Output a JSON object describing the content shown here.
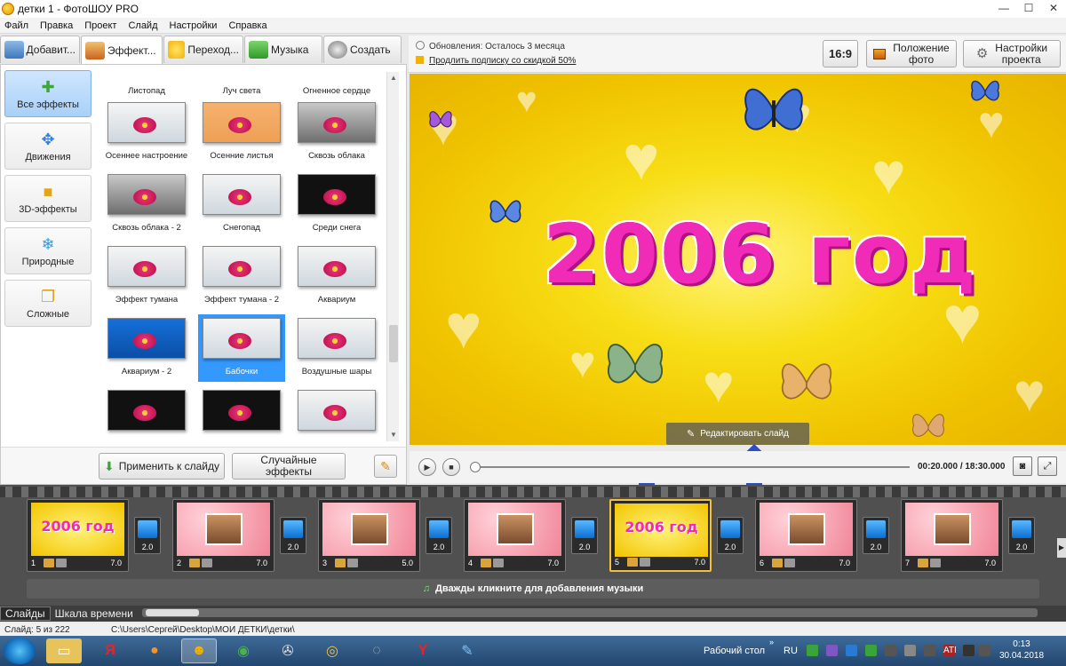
{
  "window": {
    "title": "детки 1 - ФотоШОУ PRO"
  },
  "menu": [
    "Файл",
    "Правка",
    "Проект",
    "Слайд",
    "Настройки",
    "Справка"
  ],
  "left_tabs": [
    "Добавит...",
    "Эффект...",
    "Переход...",
    "Музыка",
    "Создать"
  ],
  "categories": [
    "Все эффекты",
    "Движения",
    "3D-эффекты",
    "Природные",
    "Сложные"
  ],
  "effects_top_row": [
    "Листопад",
    "Луч света",
    "Огненное сердце"
  ],
  "effects": [
    {
      "label": "Осеннее настроение",
      "style": "white"
    },
    {
      "label": "Осенние листья",
      "style": "autumn"
    },
    {
      "label": "Сквозь облака",
      "style": "cloud"
    },
    {
      "label": "Сквозь облака - 2",
      "style": "cloud"
    },
    {
      "label": "Снегопад",
      "style": "white"
    },
    {
      "label": "Среди снега",
      "style": "dark"
    },
    {
      "label": "Эффект тумана",
      "style": "white"
    },
    {
      "label": "Эффект тумана - 2",
      "style": "white"
    },
    {
      "label": "Аквариум",
      "style": "white"
    },
    {
      "label": "Аквариум - 2",
      "style": "blue"
    },
    {
      "label": "Бабочки",
      "style": "white",
      "selected": true
    },
    {
      "label": "Воздушные шары",
      "style": "white"
    },
    {
      "label": "",
      "style": "dark"
    },
    {
      "label": "",
      "style": "dark"
    },
    {
      "label": "",
      "style": "white"
    }
  ],
  "buttons": {
    "apply": "Применить к слайду",
    "random_line1": "Случайные",
    "random_line2": "эффекты"
  },
  "updates": {
    "text": "Обновления: Осталось 3 месяца",
    "promo": "Продлить подписку со скидкой 50%"
  },
  "toolbar": {
    "ratio": "16:9",
    "photo_pos_1": "Положение",
    "photo_pos_2": "фото",
    "settings_1": "Настройки",
    "settings_2": "проекта"
  },
  "preview": {
    "title": "2006 год",
    "edit_label": "Редактировать слайд"
  },
  "playback": {
    "timecode": "00:20.000 / 18:30.000",
    "progress_fraction": 0.0
  },
  "slides": [
    {
      "num": "1",
      "dur": "7.0",
      "kind": "yellow",
      "text": "2006 год"
    },
    {
      "num": "2",
      "dur": "7.0",
      "kind": "pink",
      "text": ""
    },
    {
      "num": "3",
      "dur": "5.0",
      "kind": "pink",
      "text": ""
    },
    {
      "num": "4",
      "dur": "7.0",
      "kind": "pink",
      "text": ""
    },
    {
      "num": "5",
      "dur": "7.0",
      "kind": "yellow",
      "text": "2006 год",
      "selected": true
    },
    {
      "num": "6",
      "dur": "7.0",
      "kind": "pink",
      "text": ""
    },
    {
      "num": "7",
      "dur": "7.0",
      "kind": "pink",
      "text": ""
    }
  ],
  "transitions": [
    "2.0",
    "2.0",
    "2.0",
    "2.0",
    "2.0",
    "2.0",
    "2.0"
  ],
  "music_hint": "Дважды кликните для добавления музыки",
  "bottom_tabs": [
    "Слайды",
    "Шкала времени"
  ],
  "status": {
    "slide": "Слайд: 5 из 222",
    "path": "C:\\Users\\Сергей\\Desktop\\МОИ ДЕТКИ\\детки\\"
  },
  "taskbar": {
    "desktop": "Рабочий стол",
    "lang": "RU",
    "time": "0:13",
    "date": "30.04.2018"
  },
  "colors": {
    "accent_selected": "#3399ff",
    "title_pink": "#f02bb7",
    "arrow_blue": "#2d4cc8"
  }
}
